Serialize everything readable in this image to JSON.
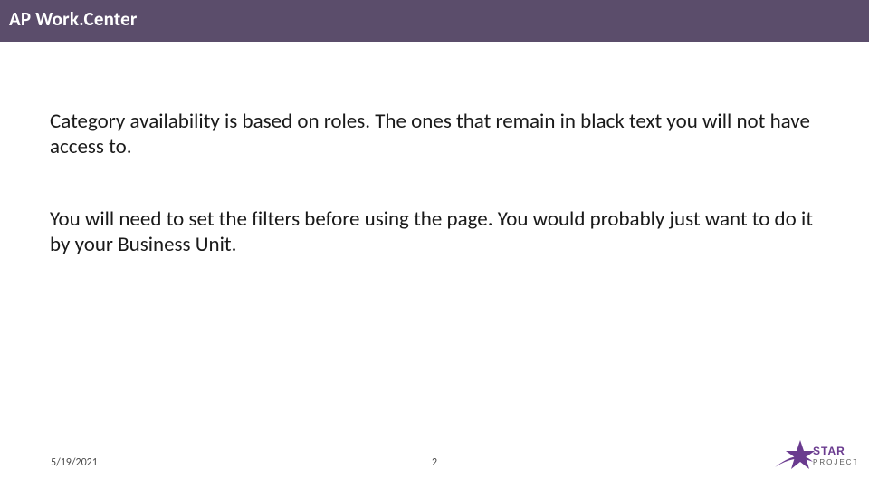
{
  "header": {
    "title": "AP  Work.Center"
  },
  "body": {
    "p1": "Category availability is based on roles.  The ones that remain in black text you will not have access to.",
    "p2": "You will need to set the filters before using the page.  You would probably just want to do it by your Business Unit."
  },
  "footer": {
    "date": "5/19/2021",
    "page": "2",
    "logo_label": "STAR PROJECT"
  },
  "colors": {
    "header_bg": "#5b4d6b",
    "logo_star": "#6a3b8f",
    "logo_text": "#6a3b8f"
  }
}
